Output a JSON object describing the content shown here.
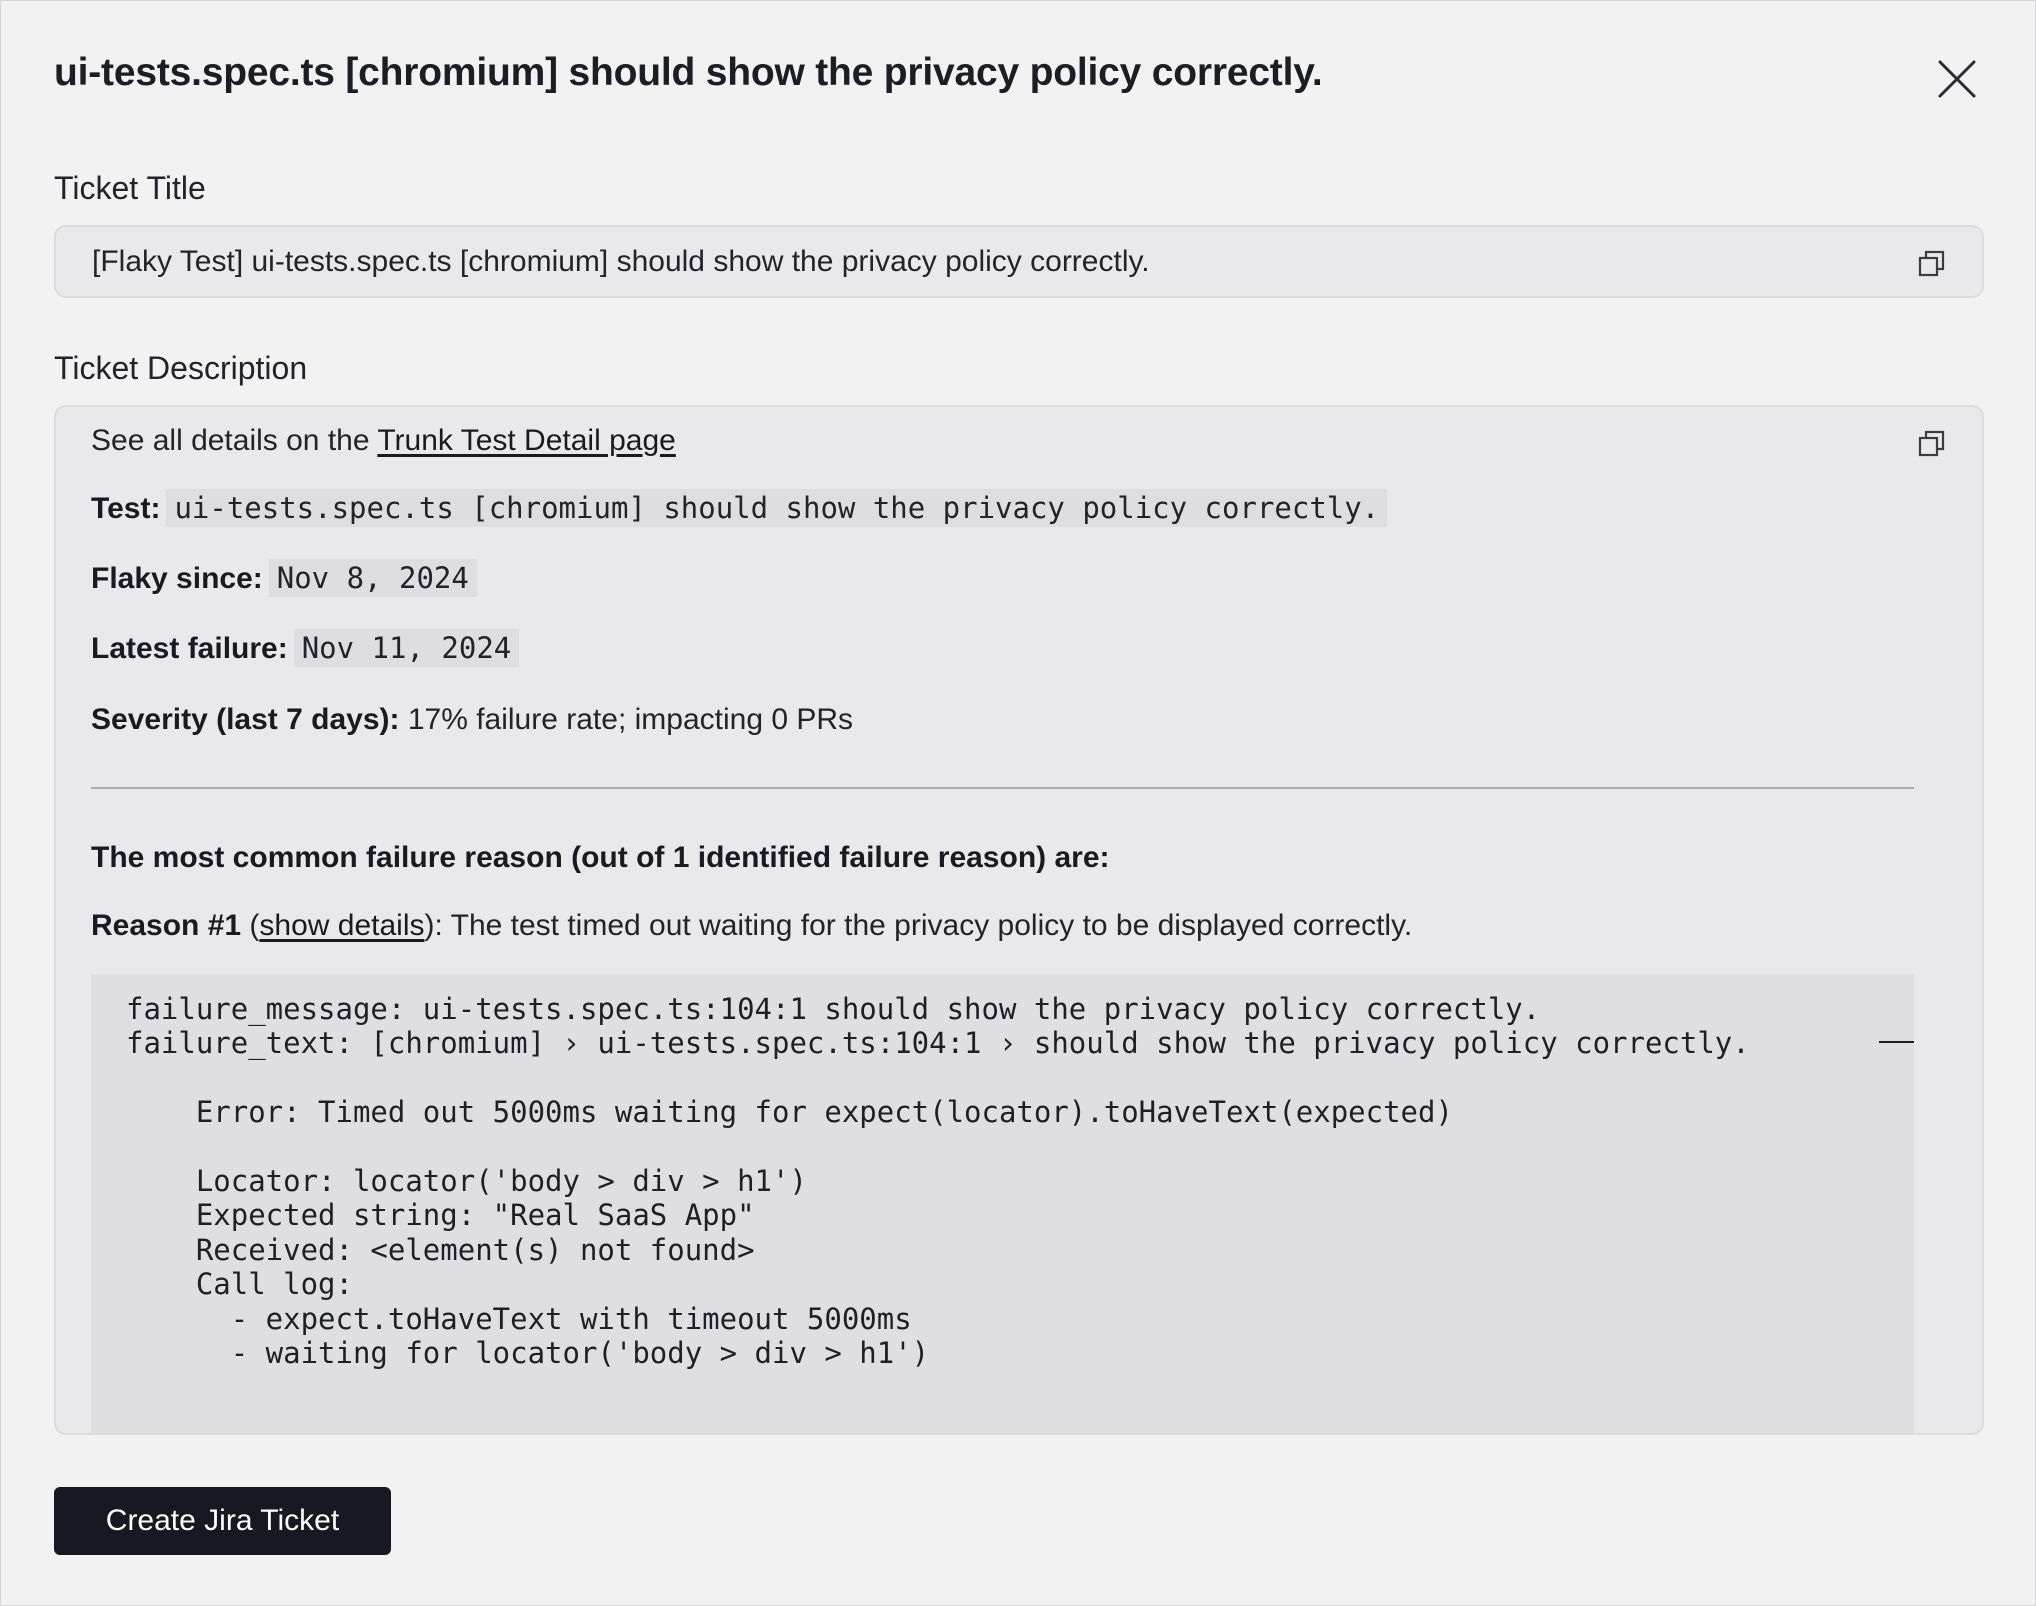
{
  "modal": {
    "title": "ui-tests.spec.ts [chromium] should show the privacy policy correctly.",
    "close_icon": "close-icon"
  },
  "ticket_title": {
    "label": "Ticket Title",
    "value": "[Flaky Test] ui-tests.spec.ts [chromium] should show the privacy policy correctly.",
    "copy_icon": "copy-icon"
  },
  "ticket_description": {
    "label": "Ticket Description",
    "copy_icon": "copy-icon",
    "intro_text": "See all details on the ",
    "intro_link": "Trunk Test Detail page",
    "test_label": "Test:",
    "test_value": "ui-tests.spec.ts [chromium] should show the privacy policy correctly.",
    "flaky_since_label": "Flaky since:",
    "flaky_since_value": "Nov 8, 2024",
    "latest_failure_label": "Latest failure:",
    "latest_failure_value": "Nov 11, 2024",
    "severity_label": "Severity (last 7 days):",
    "severity_value": "17% failure rate; impacting 0 PRs",
    "common_failure_heading": "The most common failure reason (out of 1 identified failure reason) are:",
    "reason_label": "Reason #1",
    "reason_open": " (",
    "reason_link": "show details",
    "reason_text": "): The test timed out waiting for the privacy policy to be displayed correctly.",
    "code": "failure_message: ui-tests.spec.ts:104:1 should show the privacy policy correctly.\nfailure_text: [chromium] › ui-tests.spec.ts:104:1 › should show the privacy policy correctly.\n\n    Error: Timed out 5000ms waiting for expect(locator).toHaveText(expected)\n\n    Locator: locator('body > div > h1')\n    Expected string: \"Real SaaS App\"\n    Received: <element(s) not found>\n    Call log:\n      - expect.toHaveText with timeout 5000ms\n      - waiting for locator('body > div > h1')"
  },
  "actions": {
    "create_jira_label": "Create Jira Ticket"
  }
}
